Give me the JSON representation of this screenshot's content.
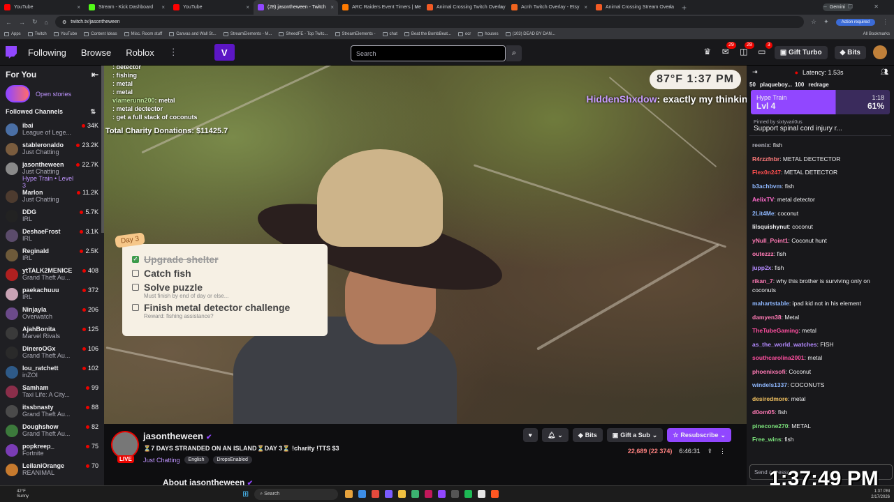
{
  "browser": {
    "tabs": [
      {
        "label": "YouTube",
        "color": "#ff0000"
      },
      {
        "label": "Stream - Kick Dashboard",
        "color": "#53fc18"
      },
      {
        "label": "YouTube",
        "color": "#ff0000"
      },
      {
        "label": "(28) jasontheween - Twitch",
        "color": "#9147ff",
        "active": true
      },
      {
        "label": "ARC Raiders Event Timers | Me",
        "color": "#ff7a00"
      },
      {
        "label": "Animal Crossing Twitch Overlay",
        "color": "#f25a24"
      },
      {
        "label": "Acnh Twitch Overlay - Etsy",
        "color": "#f1641e"
      },
      {
        "label": "Animal Crossing Stream Overla",
        "color": "#f25a24"
      }
    ],
    "gemini": "Gemini",
    "url": "twitch.tv/jasontheween",
    "action_required": "Action required",
    "bookmarks": [
      "Apps",
      "Twitch",
      "YouTube",
      "Content Ideas",
      "Misc. Room stuff",
      "Canvas and Wall St...",
      "StreamElements - M...",
      "SheedFE - Top Twitc...",
      "StreamElements -",
      "chat",
      "Beat the BombBeat...",
      "ocr",
      "houses",
      "(103) DEAD BY DAN..."
    ],
    "all_bookmarks": "All Bookmarks"
  },
  "twitch_nav": {
    "links": [
      "Following",
      "Browse",
      "Roblox"
    ],
    "search_placeholder": "Search",
    "badges": [
      "29",
      "28",
      "3"
    ],
    "gift_turbo": "Gift Turbo",
    "bits": "Bits"
  },
  "sidebar": {
    "for_you": "For You",
    "open_stories": "Open stories",
    "followed_channels": "Followed Channels",
    "channels": [
      {
        "name": "ibai",
        "game": "League of Lege...",
        "viewers": "34K",
        "color": "#4a6fa5"
      },
      {
        "name": "stableronaldo",
        "game": "Just Chatting",
        "viewers": "23.2K",
        "color": "#7a5c3e"
      },
      {
        "name": "jasontheween",
        "game": "Just Chatting",
        "viewers": "22.7K",
        "hype": "Hype Train • Level 3",
        "color": "#8a8a8a"
      },
      {
        "name": "Marlon",
        "game": "Just Chatting",
        "viewers": "11.2K",
        "color": "#4d3b2f"
      },
      {
        "name": "DDG",
        "game": "IRL",
        "viewers": "5.7K",
        "color": "#222222"
      },
      {
        "name": "DeshaeFrost",
        "game": "IRL",
        "viewers": "3.1K",
        "color": "#5b4b6b"
      },
      {
        "name": "Reginald",
        "game": "IRL",
        "viewers": "2.5K",
        "color": "#6e5a3a"
      },
      {
        "name": "ytTALK2MENICE",
        "game": "Grand Theft Au...",
        "viewers": "408",
        "color": "#b02020"
      },
      {
        "name": "paekachuuu",
        "game": "IRL",
        "viewers": "372",
        "color": "#c9a3b5"
      },
      {
        "name": "Ninjayla",
        "game": "Overwatch",
        "viewers": "206",
        "color": "#6b4a8a"
      },
      {
        "name": "AjahBonita",
        "game": "Marvel Rivals",
        "viewers": "125",
        "color": "#3a3a3a"
      },
      {
        "name": "DineroOGx",
        "game": "Grand Theft Au...",
        "viewers": "106",
        "color": "#2a2a2a"
      },
      {
        "name": "lou_ratchett",
        "game": "inZOI",
        "viewers": "102",
        "color": "#2e5a88"
      },
      {
        "name": "Samham",
        "game": "Taxi Life: A City...",
        "viewers": "99",
        "color": "#8a2e4a"
      },
      {
        "name": "itssbnasty",
        "game": "Grand Theft Au...",
        "viewers": "88",
        "color": "#4a4a4a"
      },
      {
        "name": "Doughshow",
        "game": "Grand Theft Au...",
        "viewers": "82",
        "color": "#3c7a3c"
      },
      {
        "name": "popkreep_",
        "game": "Fortnite",
        "viewers": "75",
        "color": "#7a3cb5"
      },
      {
        "name": "LeilaniOrange",
        "game": "REANIMAL",
        "viewers": "70",
        "color": "#c77a2e"
      }
    ]
  },
  "video": {
    "chat_overlay": [
      {
        "user": "",
        "text": ": detector"
      },
      {
        "user": "",
        "text": ": fishing"
      },
      {
        "user": "",
        "text": ": metal"
      },
      {
        "user": "",
        "text": ": metal"
      },
      {
        "user": "vlamerunn200",
        "text": ": metal"
      },
      {
        "user": "",
        "text": ": metal dectector"
      },
      {
        "user": "",
        "text": ": get a full stack of coconuts"
      }
    ],
    "donations": "Total Charity Donations: $11425.7",
    "weather": "87°F 1:37 PM",
    "highlight_user": "HiddenShxdow",
    "highlight_text": ": exactly my thinking",
    "todo": {
      "day": "Day 3",
      "items": [
        {
          "text": "Upgrade shelter",
          "done": true,
          "sub": ""
        },
        {
          "text": "Catch fish",
          "done": false,
          "sub": ""
        },
        {
          "text": "Solve puzzle",
          "done": false,
          "sub": "Must finish by end of day or else..."
        },
        {
          "text": "Finish metal detector challenge",
          "done": false,
          "sub": "Reward: fishing assistance?"
        }
      ]
    }
  },
  "stream_info": {
    "name": "jasontheween",
    "title": "⏳7 DAYS STRANDED ON AN ISLAND⏳DAY 3⏳ !charity !TTS $3",
    "category": "Just Chatting",
    "tags": [
      "English",
      "DropsEnabled"
    ],
    "live": "LIVE",
    "bits": "Bits",
    "gift_sub": "Gift a Sub",
    "resubscribe": "Resubscribe",
    "viewers": "22,689 (22 374)",
    "uptime": "6:46:31",
    "about": "About jasontheween"
  },
  "chat": {
    "latency": "Latency: 1.53s",
    "gifts": [
      {
        "name": "50",
        "count": ""
      },
      {
        "name": "plaqueboy...",
        "count": "100"
      },
      {
        "name": "redrage",
        "count": ""
      }
    ],
    "hype_train": {
      "label": "Hype Train",
      "level": "Lvl 4",
      "time": "1:18",
      "percent": "61%"
    },
    "pinned_by": "Pinned by sixtyvari0us",
    "pinned_text": "Support spinal cord injury r...",
    "messages": [
      {
        "user": "reenix",
        "text": ": fish",
        "color": "#adadb8"
      },
      {
        "user": "R4rzzfnbr",
        "text": ": METAL DECTECTOR",
        "color": "#ff7a7a"
      },
      {
        "user": "Flex0n247",
        "text": ": METAL DETECTOR",
        "color": "#ff4f4f"
      },
      {
        "user": "b3achbvm",
        "text": ": fish",
        "color": "#8fb8ff"
      },
      {
        "user": "AelixTV",
        "text": ": metal detector",
        "color": "#ff6bcb"
      },
      {
        "user": "2Lit4Me",
        "text": ": coconut",
        "color": "#8fb8ff"
      },
      {
        "user": "lilsquishynut",
        "text": ": coconut",
        "color": "#efeff1"
      },
      {
        "user": "yNull_Point1",
        "text": ": Coconut hunt",
        "color": "#ff7ab5"
      },
      {
        "user": "outezzz",
        "text": ": fish",
        "color": "#ff7ab5"
      },
      {
        "user": "jupp2x",
        "text": ": fish",
        "color": "#b48aff"
      },
      {
        "user": "rikan_7",
        "text": ": why this brother is surviving only on coconuts",
        "color": "#ff7ab5",
        "wrap": true
      },
      {
        "user": "mahartstable",
        "text": ": ipad kid not in his element",
        "color": "#8fb8ff"
      },
      {
        "user": "damyen38",
        "text": ": Metal",
        "color": "#ff7ab5"
      },
      {
        "user": "TheTubeGaming",
        "text": ": metal",
        "color": "#ff4fa0"
      },
      {
        "user": "as_the_world_watches",
        "text": ": FISH",
        "color": "#b48aff"
      },
      {
        "user": "southcarolina2001",
        "text": ": metal",
        "color": "#ff4fa0"
      },
      {
        "user": "phoenixsofi",
        "text": ": Coconut",
        "color": "#ff7ab5"
      },
      {
        "user": "windels1337",
        "text": ": COCONUTS",
        "color": "#8fb8ff"
      },
      {
        "user": "desiredmore",
        "text": ": metal",
        "color": "#f0c060"
      },
      {
        "user": "d0om05",
        "text": ": fish",
        "color": "#ff7ab5"
      },
      {
        "user": "pinecone270",
        "text": ": METAL",
        "color": "#7ae07a"
      },
      {
        "user": "Free_wins",
        "text": ": fish",
        "color": "#7ae07a"
      }
    ],
    "input_placeholder": "Send a message",
    "big_clock": "1:37:49 PM"
  },
  "taskbar": {
    "temp": "42°F",
    "condition": "Sunny",
    "search": "Search",
    "time": "1:37 PM",
    "date": "2/17/2026"
  }
}
